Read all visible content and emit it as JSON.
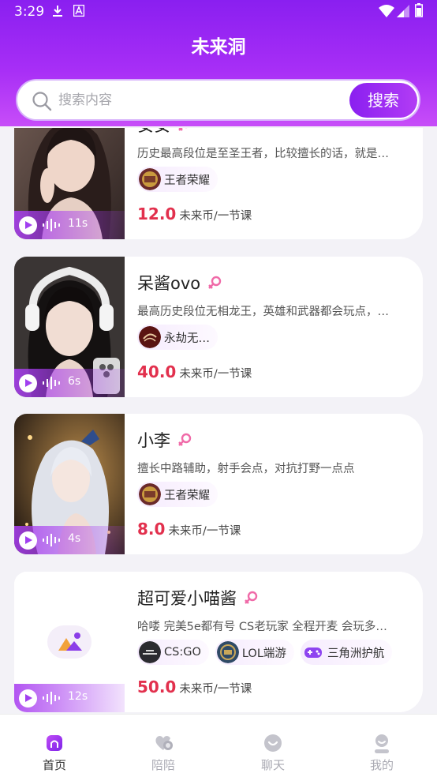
{
  "status_bar": {
    "time": "3:29"
  },
  "app": {
    "title": "未来洞"
  },
  "search": {
    "placeholder": "搜索内容",
    "button_label": "搜索"
  },
  "colors": {
    "accent": "#9a2ff2",
    "price": "#e2304d",
    "gender": "#f06aa8"
  },
  "cards": [
    {
      "name": "安安",
      "gender": "female",
      "desc": "历史最高段位是至圣王者，比较擅长的话，就是…",
      "tags": [
        {
          "label": "王者荣耀",
          "icon": "honor-of-kings-icon"
        }
      ],
      "price": "12.0",
      "unit": "未来币/一节课",
      "voice_duration": "11s"
    },
    {
      "name": "呆酱ovo",
      "gender": "female",
      "desc": "最高历史段位无相龙王，英雄和武器都会玩点，…",
      "tags": [
        {
          "label": "永劫无…",
          "icon": "naraka-icon"
        }
      ],
      "price": "40.0",
      "unit": "未来币/一节课",
      "voice_duration": "6s"
    },
    {
      "name": "小李",
      "gender": "female",
      "desc": "擅长中路辅助，射手会点，对抗打野一点点",
      "tags": [
        {
          "label": "王者荣耀",
          "icon": "honor-of-kings-icon"
        }
      ],
      "price": "8.0",
      "unit": "未来币/一节课",
      "voice_duration": "4s"
    },
    {
      "name": "超可爱小喵酱",
      "gender": "female",
      "desc": "哈喽 完美5e都有号 CS老玩家 全程开麦  会玩多…",
      "tags": [
        {
          "label": "CS:GO",
          "icon": "csgo-icon"
        },
        {
          "label": "LOL端游",
          "icon": "lol-icon"
        },
        {
          "label": "三角洲护航",
          "icon": "gamepad-icon"
        }
      ],
      "price": "50.0",
      "unit": "未来币/一节课",
      "voice_duration": "12s"
    }
  ],
  "tabbar": {
    "items": [
      {
        "label": "首页",
        "icon": "home-icon",
        "active": true
      },
      {
        "label": "陪陪",
        "icon": "companion-icon",
        "active": false
      },
      {
        "label": "聊天",
        "icon": "chat-icon",
        "active": false
      },
      {
        "label": "我的",
        "icon": "profile-icon",
        "active": false
      }
    ]
  }
}
